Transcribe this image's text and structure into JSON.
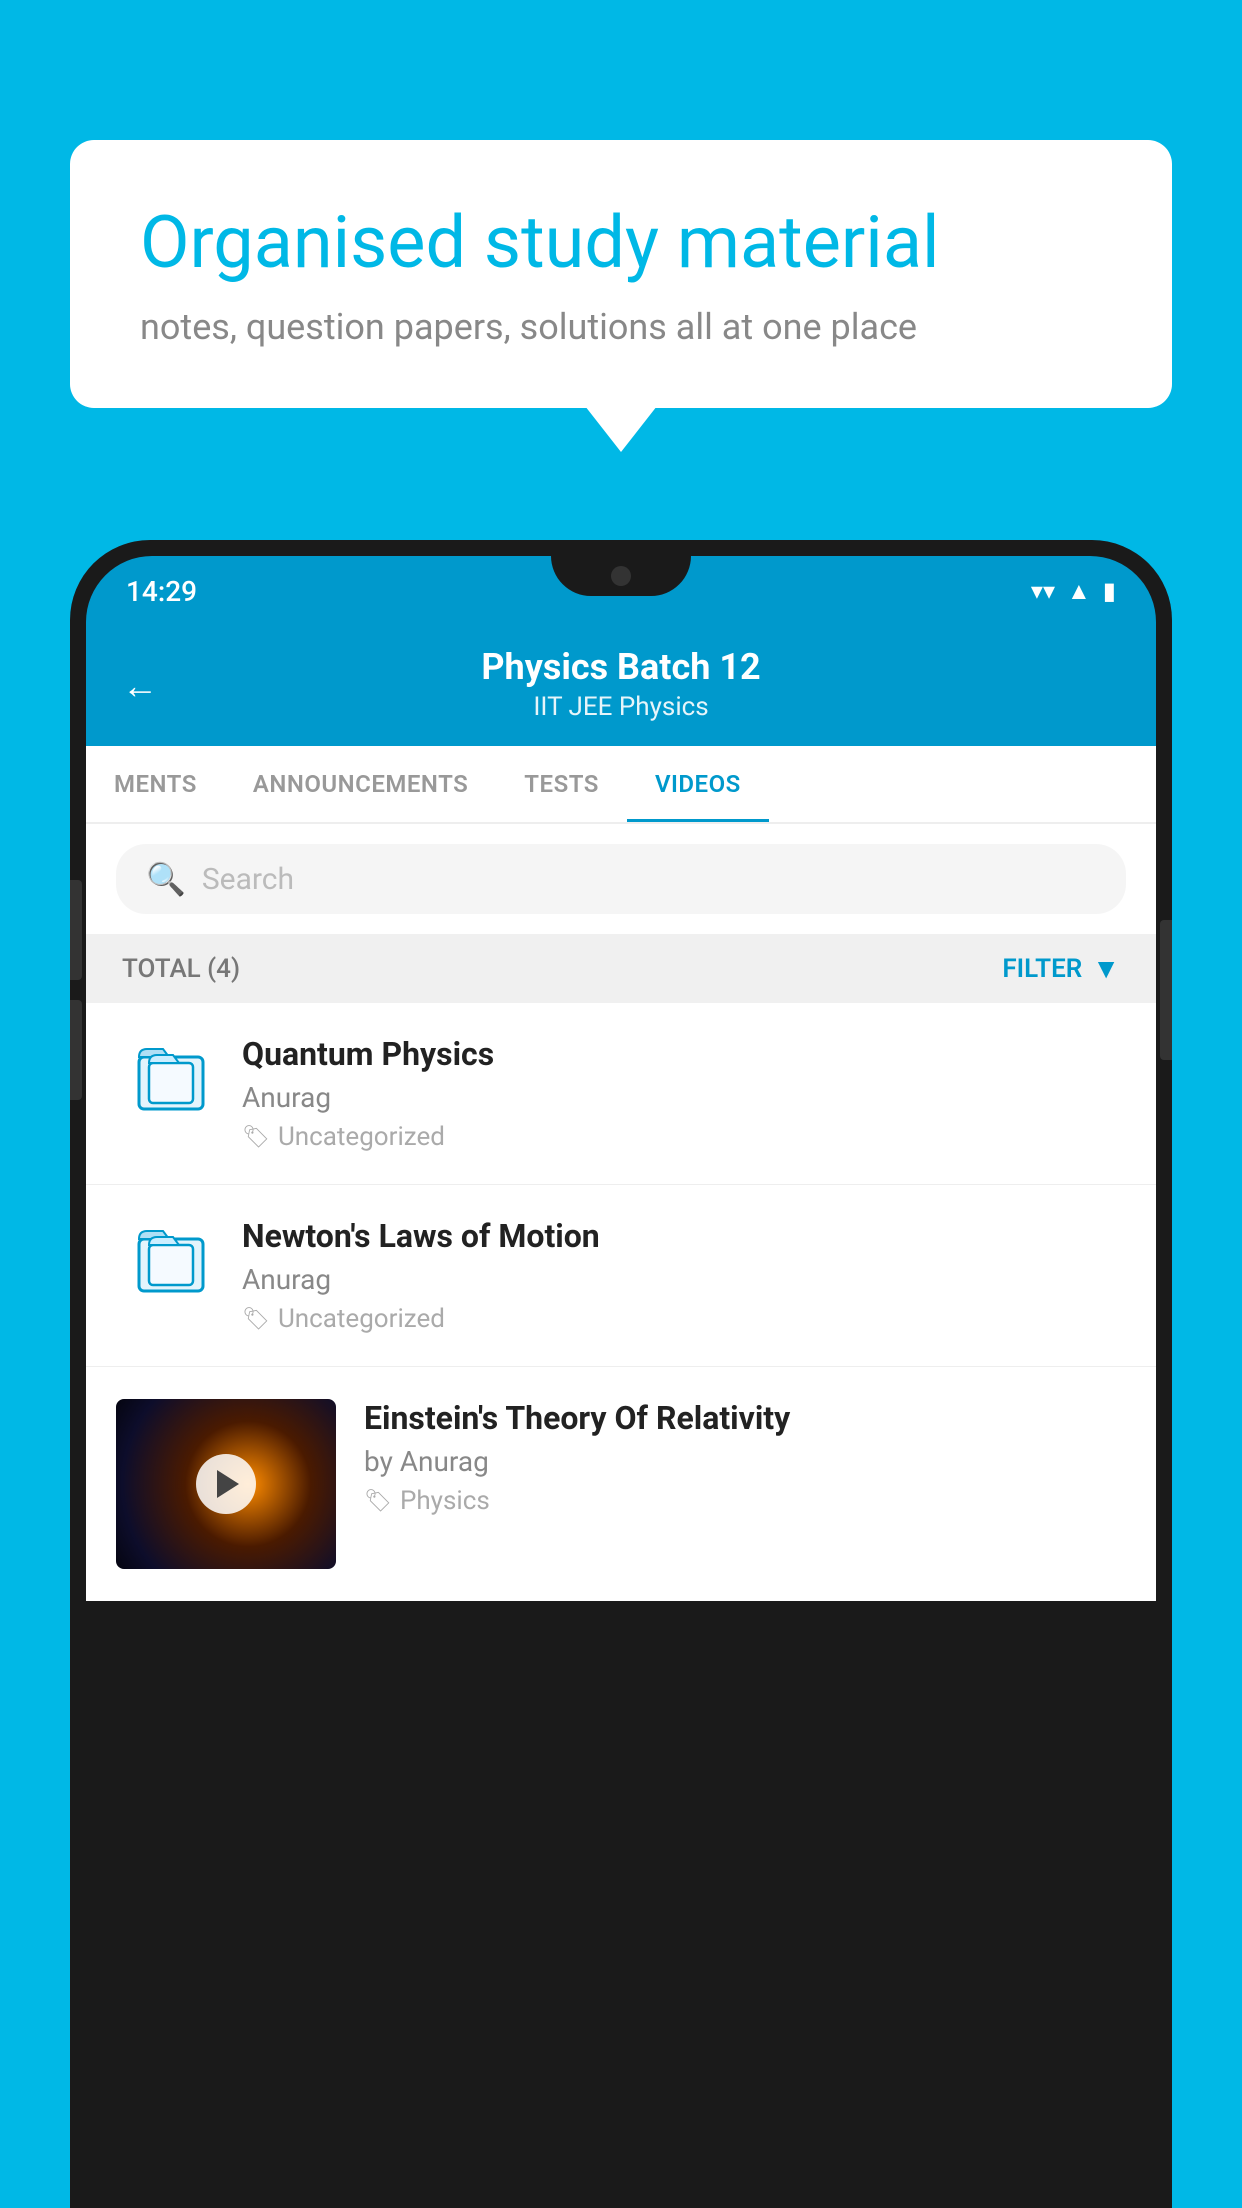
{
  "bubble": {
    "title": "Organised study material",
    "subtitle": "notes, question papers, solutions all at one place"
  },
  "status_bar": {
    "time": "14:29",
    "wifi": "▼",
    "signal": "▲",
    "battery": "▮"
  },
  "header": {
    "back_label": "←",
    "title": "Physics Batch 12",
    "subtitle": "IIT JEE   Physics"
  },
  "tabs": [
    {
      "label": "MENTS",
      "active": false
    },
    {
      "label": "ANNOUNCEMENTS",
      "active": false
    },
    {
      "label": "TESTS",
      "active": false
    },
    {
      "label": "VIDEOS",
      "active": true
    }
  ],
  "search": {
    "placeholder": "Search"
  },
  "filter_bar": {
    "total_label": "TOTAL (4)",
    "filter_label": "FILTER"
  },
  "videos": [
    {
      "title": "Quantum Physics",
      "author": "Anurag",
      "tag": "Uncategorized",
      "has_thumb": false
    },
    {
      "title": "Newton's Laws of Motion",
      "author": "Anurag",
      "tag": "Uncategorized",
      "has_thumb": false
    },
    {
      "title": "Einstein's Theory Of Relativity",
      "author": "by Anurag",
      "tag": "Physics",
      "has_thumb": true
    }
  ],
  "icons": {
    "back": "←",
    "search": "🔍",
    "filter": "▼",
    "tag": "🏷",
    "play": "▶"
  }
}
